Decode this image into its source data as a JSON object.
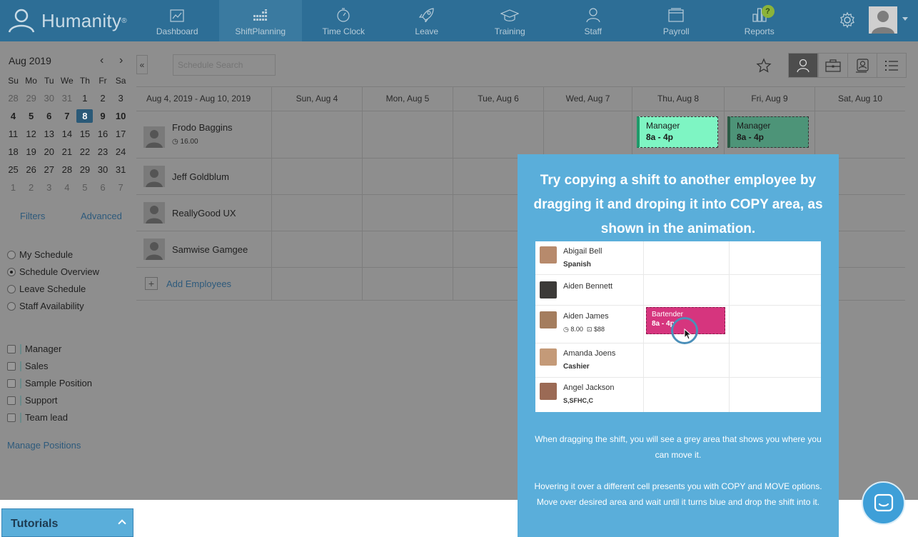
{
  "app": {
    "brand": "Humanity",
    "brand_mark": "®"
  },
  "nav": {
    "items": [
      {
        "label": "Dashboard",
        "icon": "chart-icon"
      },
      {
        "label": "ShiftPlanning",
        "icon": "calendar-grid-icon"
      },
      {
        "label": "Time Clock",
        "icon": "clock-icon"
      },
      {
        "label": "Leave",
        "icon": "rocket-icon"
      },
      {
        "label": "Training",
        "icon": "graduation-cap-icon"
      },
      {
        "label": "Staff",
        "icon": "person-icon"
      },
      {
        "label": "Payroll",
        "icon": "folder-icon"
      },
      {
        "label": "Reports",
        "icon": "bar-chart-icon"
      }
    ],
    "active": "ShiftPlanning",
    "help_badge": "?"
  },
  "calendar": {
    "month_label": "Aug 2019",
    "weekdays": [
      "Su",
      "Mo",
      "Tu",
      "We",
      "Th",
      "Fr",
      "Sa"
    ],
    "days": [
      "28",
      "29",
      "30",
      "31",
      "1",
      "2",
      "3",
      "4",
      "5",
      "6",
      "7",
      "8",
      "9",
      "10",
      "11",
      "12",
      "13",
      "14",
      "15",
      "16",
      "17",
      "18",
      "19",
      "20",
      "21",
      "22",
      "23",
      "24",
      "25",
      "26",
      "27",
      "28",
      "29",
      "30",
      "31",
      "1",
      "2",
      "3",
      "4",
      "5",
      "6",
      "7"
    ],
    "selected_day": "8"
  },
  "sidebar": {
    "filters_label": "Filters",
    "advanced_label": "Advanced",
    "views": [
      {
        "label": "My Schedule",
        "selected": false
      },
      {
        "label": "Schedule Overview",
        "selected": true
      },
      {
        "label": "Leave Schedule",
        "selected": false
      },
      {
        "label": "Staff Availability",
        "selected": false
      }
    ],
    "positions": [
      "Manager",
      "Sales",
      "Sample Position",
      "Support",
      "Team lead"
    ],
    "manage_positions": "Manage Positions"
  },
  "toolbar": {
    "search_placeholder": "Schedule Search",
    "collapse_label": "«"
  },
  "schedule": {
    "range_label": "Aug 4, 2019 - Aug 10, 2019",
    "days": [
      "Sun, Aug 4",
      "Mon, Aug 5",
      "Tue, Aug 6",
      "Wed, Aug 7",
      "Thu, Aug 8",
      "Fri, Aug 9",
      "Sat, Aug 10"
    ],
    "employees": [
      {
        "name": "Frodo Baggins",
        "hours": "16.00"
      },
      {
        "name": "Jeff Goldblum",
        "hours": ""
      },
      {
        "name": "ReallyGood UX",
        "hours": ""
      },
      {
        "name": "Samwise Gamgee",
        "hours": ""
      }
    ],
    "add_employees": "Add Employees",
    "shifts": [
      {
        "title": "Manager",
        "time": "8a - 4p",
        "day": "Thu, Aug 8"
      },
      {
        "title": "Manager",
        "time": "8a - 4p",
        "day": "Fri, Aug 9"
      }
    ]
  },
  "tooltip": {
    "title": "Try copying a shift to another employee by dragging it and droping it into COPY area, as shown in the animation.",
    "demo": {
      "rows": [
        {
          "name": "Abigail Bell",
          "sub": "Spanish"
        },
        {
          "name": "Aiden Bennett",
          "sub": ""
        },
        {
          "name": "Aiden James",
          "hours": "8.00",
          "pay": "$88"
        },
        {
          "name": "Amanda Joens",
          "sub": "Cashier"
        },
        {
          "name": "Angel Jackson",
          "sub": "S,SFHC,C"
        }
      ],
      "shift_title": "Bartender",
      "shift_time": "8a - 4p"
    },
    "paragraph1": "When dragging the shift, you will see a grey area that shows you where you can move it.",
    "paragraph2": "Hovering it over a different cell presents you with COPY and MOVE options. Move over desired area and wait until it turns blue and drop the shift into it."
  },
  "tutorials": {
    "label": "Tutorials"
  }
}
